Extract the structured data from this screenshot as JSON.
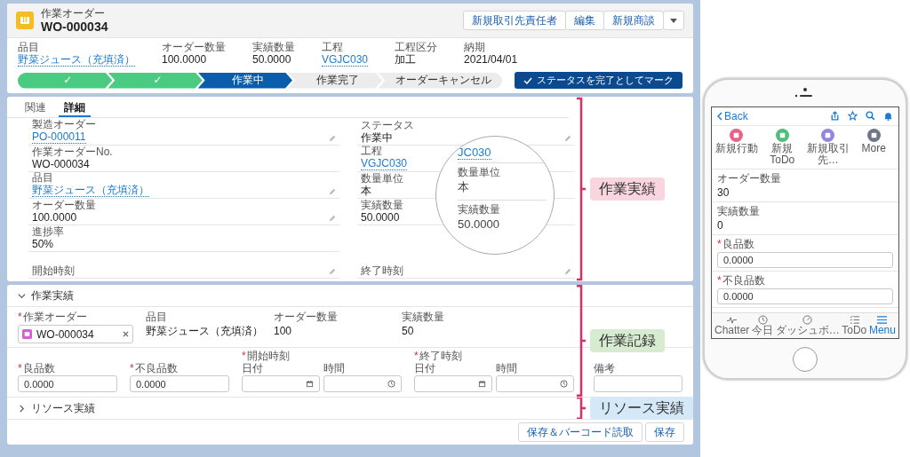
{
  "header": {
    "object_label": "作業オーダー",
    "title": "WO-000034",
    "actions": [
      "新規取引先責任者",
      "編集",
      "新規商談"
    ]
  },
  "highlights": [
    {
      "label": "品目",
      "value": "野菜ジュース（充填済）",
      "link": true
    },
    {
      "label": "オーダー数量",
      "value": "100.0000",
      "link": false
    },
    {
      "label": "実績数量",
      "value": "50.0000",
      "link": false
    },
    {
      "label": "工程",
      "value": "VGJC030",
      "link": true
    },
    {
      "label": "工程区分",
      "value": "加工",
      "link": false
    },
    {
      "label": "納期",
      "value": "2021/04/01",
      "link": false
    }
  ],
  "path": {
    "steps": [
      {
        "label": "✓",
        "completed": true,
        "selected": false
      },
      {
        "label": "✓",
        "completed": true,
        "selected": false
      },
      {
        "label": "作業中",
        "completed": false,
        "selected": true
      },
      {
        "label": "作業完了",
        "completed": false,
        "selected": false
      },
      {
        "label": "オーダーキャンセル",
        "completed": false,
        "selected": false
      }
    ],
    "mark_button": "ステータスを完了としてマーク"
  },
  "detail": {
    "tabs": [
      {
        "label": "関連",
        "selected": false
      },
      {
        "label": "詳細",
        "selected": true
      }
    ],
    "left_fields": [
      {
        "label": "製造オーダー",
        "value": "PO-000011",
        "link": true,
        "editable": true
      },
      {
        "label": "作業オーダーNo.",
        "value": "WO-000034",
        "link": false,
        "editable": false
      },
      {
        "label": "品目",
        "value": "野菜ジュース（充填済）",
        "link": true,
        "editable": true
      },
      {
        "label": "オーダー数量",
        "value": "100.0000",
        "link": false,
        "editable": true
      },
      {
        "label": "進捗率",
        "value": "50%",
        "link": false,
        "editable": false
      },
      {
        "label": "開始時刻",
        "editable": true
      }
    ],
    "right_fields": [
      {
        "label": "ステータス",
        "value": "作業中",
        "link": false,
        "editable": true
      },
      {
        "label": "工程",
        "value": "VGJC030",
        "link": true,
        "editable": false
      },
      {
        "label": "数量単位",
        "value": "本",
        "link": false,
        "editable": false
      },
      {
        "label": "実績数量",
        "value": "50.0000",
        "link": false,
        "editable": false
      },
      {
        "label": "終了時刻",
        "editable": true
      }
    ],
    "magnifier": {
      "link": "JC030",
      "fields": [
        {
          "label": "数量単位",
          "value": "本"
        },
        {
          "label": "実績数量",
          "value": "50.0000"
        }
      ]
    },
    "annotation": {
      "label": "作業実績",
      "color": "#f8d5df"
    }
  },
  "form": {
    "sections": [
      {
        "title": "作業実績",
        "expanded": true,
        "row1": [
          {
            "kind": "lookup",
            "label": "作業オーダー",
            "marker": "*",
            "value": "WO-000034"
          },
          {
            "kind": "readonly",
            "label": "品目",
            "value": "野菜ジュース（充填済）"
          },
          {
            "kind": "readonly",
            "label": "オーダー数量",
            "value": "100"
          },
          {
            "kind": "readonly",
            "label": "実績数量",
            "value": "50"
          }
        ],
        "row2": [
          {
            "kind": "input",
            "label": "良品数",
            "marker": "*",
            "value": "0.0000"
          },
          {
            "kind": "input",
            "label": "不良品数",
            "marker": "*",
            "value": "0.0000"
          },
          {
            "kind": "datetime",
            "label": "開始時刻",
            "marker": "*",
            "date_label": "日付",
            "time_label": "時間"
          },
          {
            "kind": "datetime",
            "label": "終了時刻",
            "marker": "*",
            "date_label": "日付",
            "time_label": "時間"
          },
          {
            "kind": "note",
            "label": "備考"
          }
        ],
        "annotation": {
          "label": "作業記録",
          "color": "#d6ebd0"
        }
      },
      {
        "title": "リソース実績",
        "expanded": false,
        "annotation": {
          "label": "リソース実績",
          "color": "#d4e8f8"
        }
      }
    ],
    "buttons": [
      "保存＆バーコード読取",
      "保存"
    ]
  },
  "phone": {
    "back": "Back",
    "actions": [
      {
        "label": "新規行動",
        "color": "#e8628a"
      },
      {
        "label": "新規ToDo",
        "color": "#4cbf78"
      },
      {
        "label": "新規取引先…",
        "color": "#9486e0"
      },
      {
        "label": "More",
        "color": "#6f7787"
      }
    ],
    "fields": [
      {
        "kind": "readonly",
        "label": "オーダー数量",
        "value": "30"
      },
      {
        "kind": "readonly",
        "label": "実績数量",
        "value": "0"
      },
      {
        "kind": "input",
        "label": "良品数",
        "marker": "*",
        "value": "0.0000"
      },
      {
        "kind": "input",
        "label": "不良品数",
        "marker": "*",
        "value": "0.0000"
      }
    ],
    "tabs": [
      {
        "label": "Chatter",
        "selected": false
      },
      {
        "label": "今日",
        "selected": false
      },
      {
        "label": "ダッシュボ…",
        "selected": false
      },
      {
        "label": "ToDo",
        "selected": false
      },
      {
        "label": "Menu",
        "selected": true
      }
    ]
  }
}
